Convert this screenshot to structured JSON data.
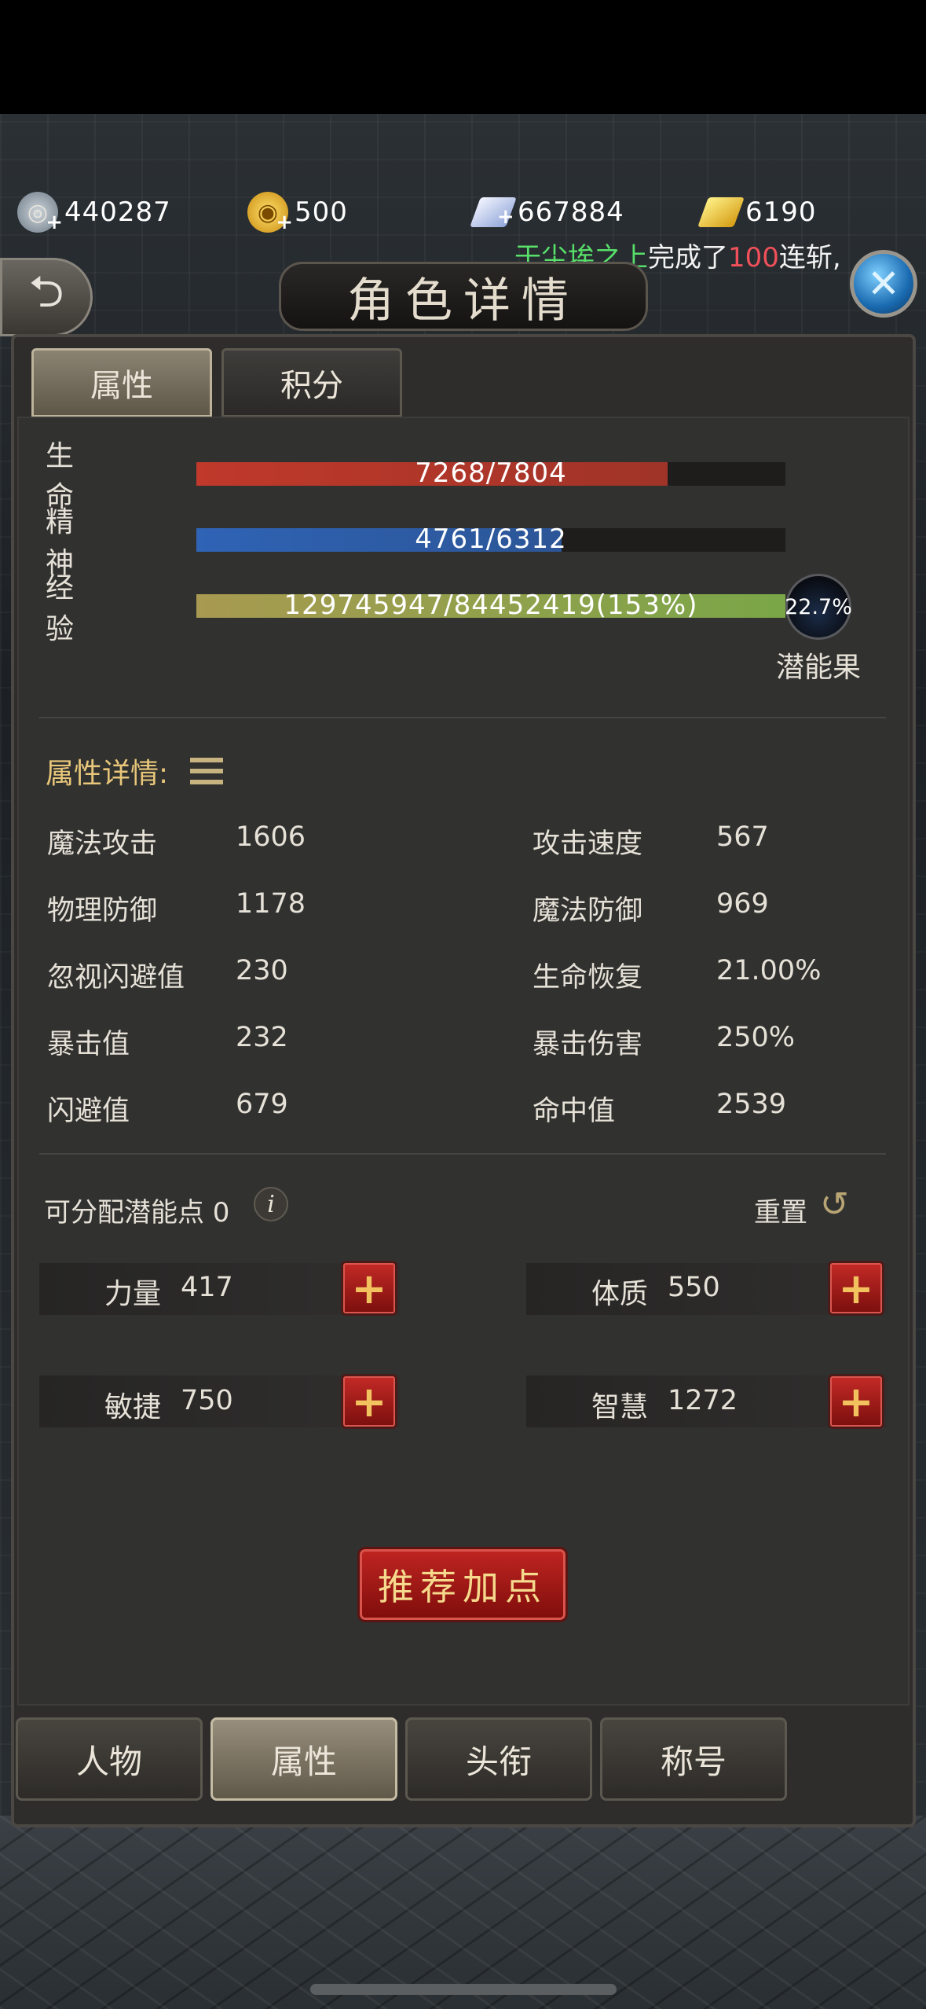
{
  "currencies": [
    {
      "icon": "silver-coin-icon",
      "value": "440287"
    },
    {
      "icon": "gold-coin-icon",
      "value": "500"
    },
    {
      "icon": "diamond-icon",
      "value": "667884"
    },
    {
      "icon": "gold-bar-icon",
      "value": "6190"
    }
  ],
  "ticker": {
    "player": "于尘埃之上",
    "mid": "完成了",
    "count": "100",
    "suffix": "连斩,"
  },
  "header": {
    "title": "角色详情",
    "back_icon": "back-arrow-icon",
    "close_icon": "close-icon"
  },
  "tabs": [
    {
      "label": "属性",
      "active": true
    },
    {
      "label": "积分",
      "active": false
    }
  ],
  "bars": [
    {
      "label": "生命",
      "text": "7268/7804",
      "fraction": 0.8,
      "color": "#c0392b"
    },
    {
      "label": "精神",
      "text": "4761/6312",
      "fraction": 0.62,
      "color": "#2f63b5"
    },
    {
      "label": "经验",
      "text": "129745947/84452419(153%)",
      "fraction": 1.0,
      "color": "#7aa648"
    }
  ],
  "orb": {
    "value": "22.7%",
    "label": "潜能果"
  },
  "details_title": "属性详情:",
  "attributes": [
    {
      "name": "魔法攻击",
      "value": "1606"
    },
    {
      "name": "攻击速度",
      "value": "567"
    },
    {
      "name": "物理防御",
      "value": "1178"
    },
    {
      "name": "魔法防御",
      "value": "969"
    },
    {
      "name": "忽视闪避值",
      "value": "230"
    },
    {
      "name": "生命恢复",
      "value": "21.00%"
    },
    {
      "name": "暴击值",
      "value": "232"
    },
    {
      "name": "暴击伤害",
      "value": "250%"
    },
    {
      "name": "闪避值",
      "value": "679"
    },
    {
      "name": "命中值",
      "value": "2539"
    }
  ],
  "points": {
    "label": "可分配潜能点 0",
    "reset": "重置"
  },
  "stats": [
    {
      "name": "力量",
      "value": "417"
    },
    {
      "name": "体质",
      "value": "550"
    },
    {
      "name": "敏捷",
      "value": "750"
    },
    {
      "name": "智慧",
      "value": "1272"
    }
  ],
  "recommend_label": "推荐加点",
  "nav": [
    {
      "label": "人物",
      "active": false
    },
    {
      "label": "属性",
      "active": true
    },
    {
      "label": "头衔",
      "active": false
    },
    {
      "label": "称号",
      "active": false
    }
  ]
}
